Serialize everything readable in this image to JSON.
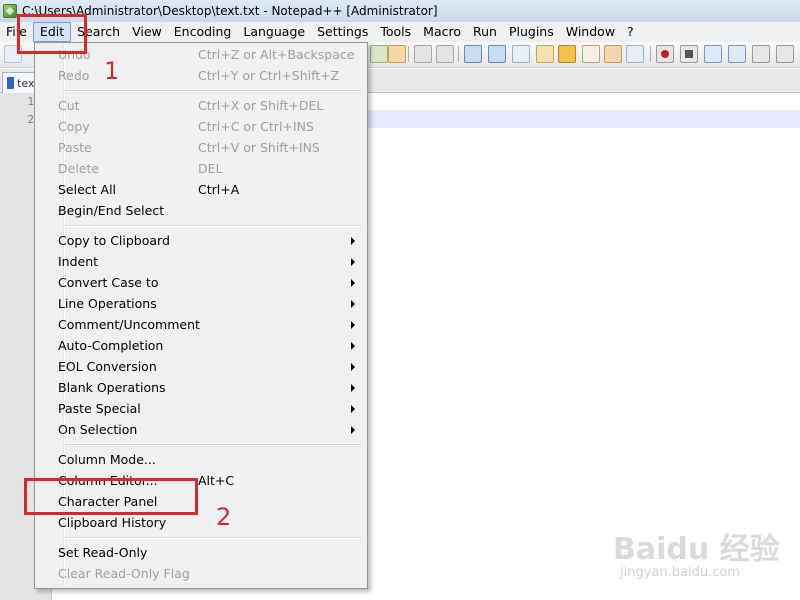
{
  "window": {
    "title": "C:\\Users\\Administrator\\Desktop\\text.txt - Notepad++ [Administrator]"
  },
  "menubar": {
    "items": [
      "File",
      "Edit",
      "Search",
      "View",
      "Encoding",
      "Language",
      "Settings",
      "Tools",
      "Macro",
      "Run",
      "Plugins",
      "Window",
      "?"
    ],
    "active": "Edit"
  },
  "tab": {
    "label": "text.txt"
  },
  "editor": {
    "line_numbers": [
      "1",
      "2"
    ]
  },
  "edit_menu": {
    "items": [
      {
        "label": "Undo",
        "shortcut": "Ctrl+Z or Alt+Backspace",
        "disabled": true
      },
      {
        "label": "Redo",
        "shortcut": "Ctrl+Y or Ctrl+Shift+Z",
        "disabled": true
      },
      {
        "label": "Cut",
        "shortcut": "Ctrl+X or Shift+DEL",
        "disabled": true
      },
      {
        "label": "Copy",
        "shortcut": "Ctrl+C or Ctrl+INS",
        "disabled": true
      },
      {
        "label": "Paste",
        "shortcut": "Ctrl+V or Shift+INS",
        "disabled": true
      },
      {
        "label": "Delete",
        "shortcut": "DEL",
        "disabled": true
      },
      {
        "label": "Select All",
        "shortcut": "Ctrl+A",
        "disabled": false
      },
      {
        "label": "Begin/End Select",
        "shortcut": "",
        "disabled": false
      },
      {
        "label": "Copy to Clipboard",
        "submenu": true
      },
      {
        "label": "Indent",
        "submenu": true
      },
      {
        "label": "Convert Case to",
        "submenu": true
      },
      {
        "label": "Line Operations",
        "submenu": true
      },
      {
        "label": "Comment/Uncomment",
        "submenu": true
      },
      {
        "label": "Auto-Completion",
        "submenu": true
      },
      {
        "label": "EOL Conversion",
        "submenu": true
      },
      {
        "label": "Blank Operations",
        "submenu": true
      },
      {
        "label": "Paste Special",
        "submenu": true
      },
      {
        "label": "On Selection",
        "submenu": true
      },
      {
        "label": "Column Mode...",
        "shortcut": ""
      },
      {
        "label": "Column Editor...",
        "shortcut": "Alt+C"
      },
      {
        "label": "Character Panel",
        "shortcut": ""
      },
      {
        "label": "Clipboard History",
        "shortcut": ""
      },
      {
        "label": "Set Read-Only",
        "shortcut": ""
      },
      {
        "label": "Clear Read-Only Flag",
        "shortcut": "",
        "disabled": true
      }
    ]
  },
  "annotations": {
    "step1": "1",
    "step2": "2"
  },
  "watermark": {
    "logo": "Baidu 经验",
    "url": "jingyan.baidu.com"
  },
  "colors": {
    "annotation_red": "#d62a2a",
    "menu_bg": "#f0f0f0",
    "current_line": "#e8e8ff"
  }
}
